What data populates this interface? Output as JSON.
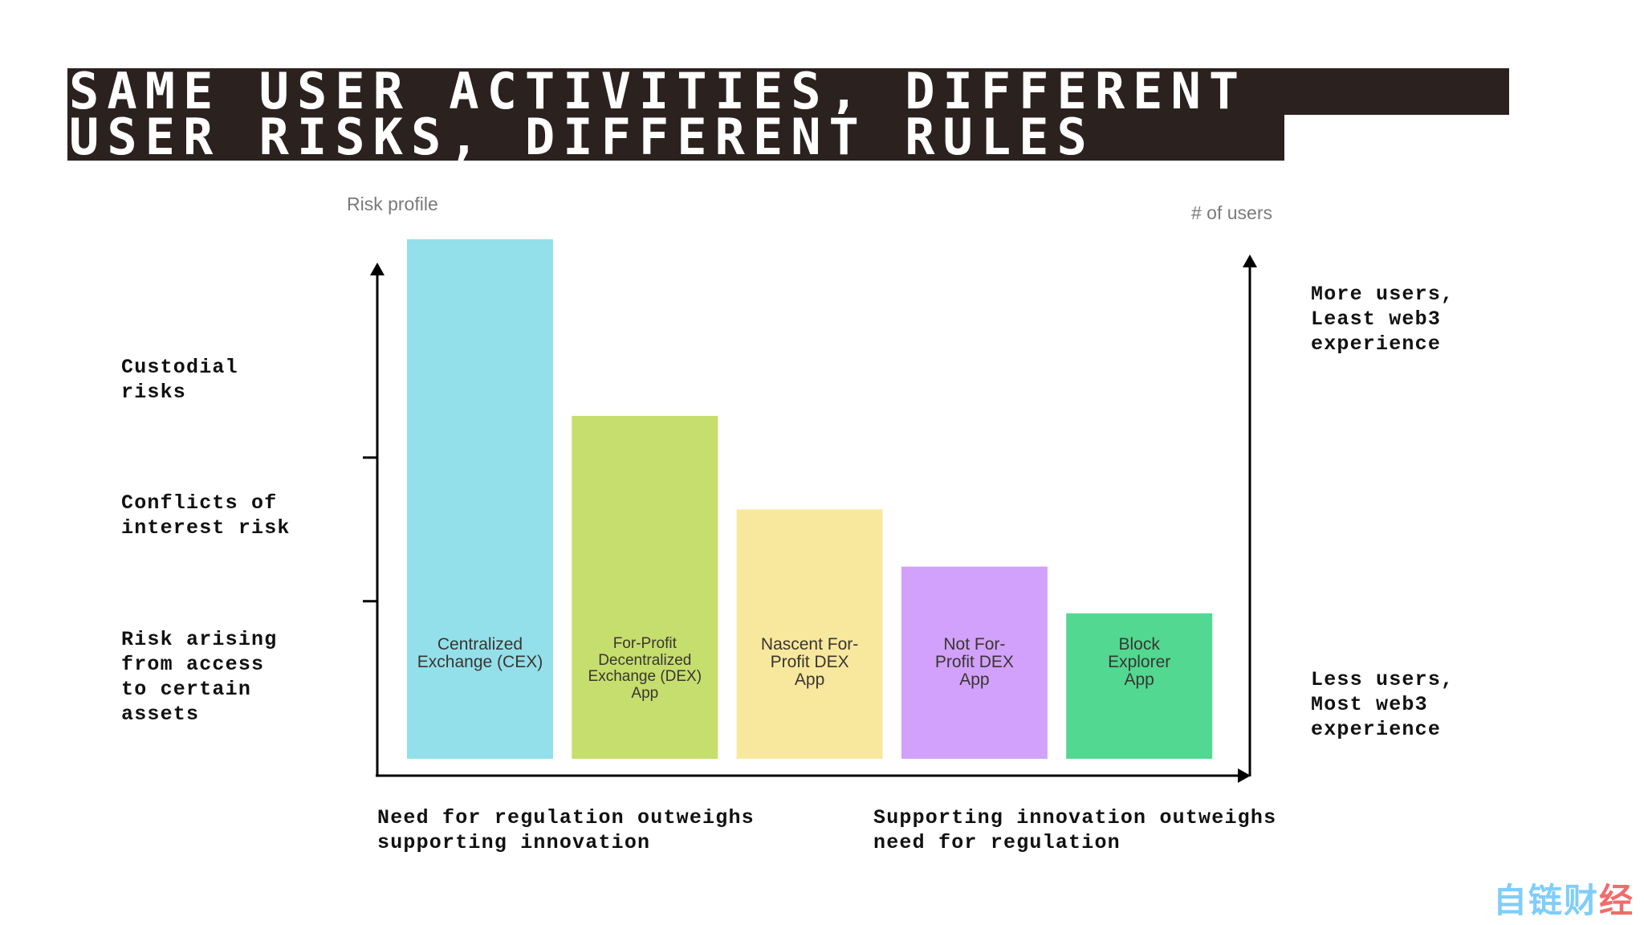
{
  "title": {
    "line1": "SAME USER ACTIVITIES, DIFFERENT",
    "line2": "USER RISKS, DIFFERENT RULES"
  },
  "colors": {
    "title_bg": "#2b2220",
    "title_text": "#ffffff",
    "axis": "#000000",
    "axis_title": "#7a7a7a",
    "bar_label": "#3a3530"
  },
  "left_labels": [
    {
      "text": "Custodial\nrisks"
    },
    {
      "text": "Conflicts of\ninterest risk"
    },
    {
      "text": "Risk arising\nfrom access\nto certain\nassets"
    }
  ],
  "right_labels": [
    {
      "text": "More users,\nLeast web3\nexperience"
    },
    {
      "text": "Less users,\nMost web3\nexperience"
    }
  ],
  "bottom_labels": [
    {
      "text": "Need for regulation outweighs\nsupporting innovation"
    },
    {
      "text": "Supporting innovation outweighs\nneed for regulation"
    }
  ],
  "watermark": {
    "text_main": "自链财",
    "text_accent": "经"
  },
  "chart_data": {
    "type": "bar",
    "title": "SAME USER ACTIVITIES, DIFFERENT USER RISKS, DIFFERENT RULES",
    "ylabel": "Risk profile",
    "y2label": "# of users",
    "xlabel": "",
    "ylim": [
      0,
      1
    ],
    "grid": false,
    "y_axis_ticks": [
      0.62,
      0.34
    ],
    "y_tick_note": "unlabeled tick marks separating risk bands (bottom band: risk arising from access to certain assets; middle: conflicts of interest risk; top: custodial risks)",
    "categories": [
      "Centralized\nExchange (CEX)",
      "For-Profit\nDecentralized\nExchange (DEX)\nApp",
      "Nascent For-\nProfit DEX\nApp",
      "Not For-\nProfit DEX\nApp",
      "Block\nExplorer\nApp"
    ],
    "values": [
      1.0,
      0.66,
      0.48,
      0.37,
      0.28
    ],
    "bar_colors": [
      "#93e0eb",
      "#c6de6d",
      "#f8e89e",
      "#d1a1fc",
      "#52d891"
    ],
    "value_note": "relative risk-profile height (CEX = 1.0); no numeric axis shown"
  }
}
